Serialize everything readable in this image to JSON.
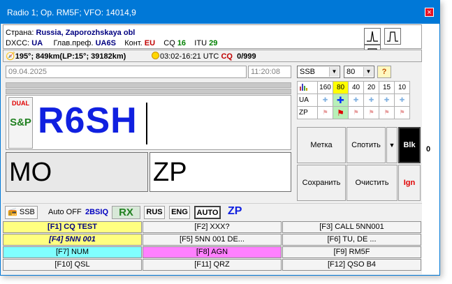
{
  "window": {
    "title": "Radio 1; Op. RM5F; VFO: 14014,9",
    "close": "×"
  },
  "info": {
    "country_label": "Страна:",
    "country": "Russia, Zaporozhskaya obl",
    "dxcc_label": "DXCC:",
    "dxcc": "UA",
    "pref_label": "Глав.преф.",
    "pref": "UA6S",
    "cont_label": "Конт.",
    "cont": "EU",
    "cq_label": "CQ",
    "cq": "16",
    "itu_label": "ITU",
    "itu": "29"
  },
  "info2": {
    "bearing": "195°; 849km(LP:15°; 39182km)",
    "sun": "03:02-16:21 UTC",
    "cq_label": "CQ",
    "count": "0/999"
  },
  "date": "09.04.2025",
  "time": "11:20:08",
  "mode": "SSB",
  "band": "80",
  "help_icon": "?",
  "band_table": {
    "header": [
      "160",
      "80",
      "40",
      "20",
      "15",
      "10"
    ],
    "rows": [
      {
        "label": "UA"
      },
      {
        "label": "ZP"
      }
    ]
  },
  "call": {
    "dual": "DUAL",
    "snp": "S&P",
    "callsign": "R6SH"
  },
  "mo": "MO",
  "zp": "ZP",
  "buttons": {
    "metka": "Метка",
    "spotit": "Спотить",
    "dropdown": "▼",
    "blk": "Blk",
    "save": "Сохранить",
    "clear": "Очистить",
    "ign": "Ign"
  },
  "status": {
    "ssb": "SSB",
    "auto_off": "Auto OFF",
    "bsiq": "2BSIQ",
    "rx": "RX",
    "rus": "RUS",
    "eng": "ENG",
    "auto": "AUTO",
    "zp": "ZP"
  },
  "fkeys": [
    "[F1] CQ TEST",
    "[F2] XXX?",
    "[F3] CALL 5NN001",
    "[F4] 5NN 001",
    "[F5] 5NN 001 DE...",
    "[F6] TU, DE ...",
    "[F7] NUM",
    "[F8] AGN",
    "[F9] RM5F",
    "[F10] QSL",
    "[F11] QRZ",
    "[F12] QSO B4"
  ],
  "side_value": "0",
  "colors": {
    "titlebar": "#0078d7",
    "callsign": "#1020e0",
    "highlight": "#ffff00"
  }
}
